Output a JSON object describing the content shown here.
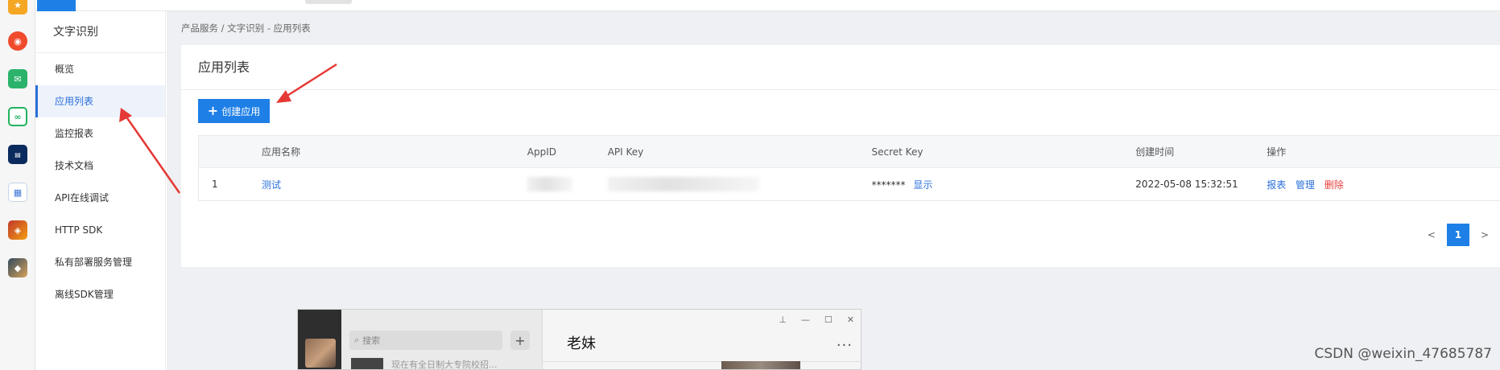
{
  "dock": {
    "icons": [
      "star-app-icon",
      "weibo-icon",
      "mail-icon",
      "cloud-icon",
      "news-app-icon",
      "doc-app-icon",
      "game-app-icon",
      "game2-app-icon"
    ]
  },
  "sidebar": {
    "title": "文字识别",
    "items": [
      {
        "label": "概览"
      },
      {
        "label": "应用列表"
      },
      {
        "label": "监控报表"
      },
      {
        "label": "技术文档"
      },
      {
        "label": "API在线调试"
      },
      {
        "label": "HTTP SDK"
      },
      {
        "label": "私有部署服务管理"
      },
      {
        "label": "离线SDK管理"
      }
    ]
  },
  "breadcrumb": "产品服务  /  文字识别 - 应用列表",
  "panel": {
    "title": "应用列表",
    "create_button": "创建应用"
  },
  "table": {
    "headers": [
      "",
      "应用名称",
      "AppID",
      "API Key",
      "Secret Key",
      "创建时间",
      "操作"
    ],
    "rows": [
      {
        "index": "1",
        "name": "测试",
        "secret_mask": "*******",
        "secret_show": "显示",
        "created": "2022-05-08 15:32:51",
        "actions": [
          "报表",
          "管理",
          "删除"
        ]
      }
    ]
  },
  "pager": {
    "prev": "<",
    "current": "1",
    "next": ">"
  },
  "wechat": {
    "search_placeholder": "搜索",
    "plus": "+",
    "preview_text": "现在有全日制大专院校招...",
    "chat_title": "老妹",
    "more": "···",
    "win_pin": "⊥",
    "win_min": "—",
    "win_max": "☐",
    "win_close": "✕"
  },
  "watermark": "CSDN @weixin_47685787",
  "colors": {
    "accent": "#1e7fe6",
    "link": "#2a6fdb",
    "danger": "#e8403c",
    "arrow": "#e53935"
  }
}
